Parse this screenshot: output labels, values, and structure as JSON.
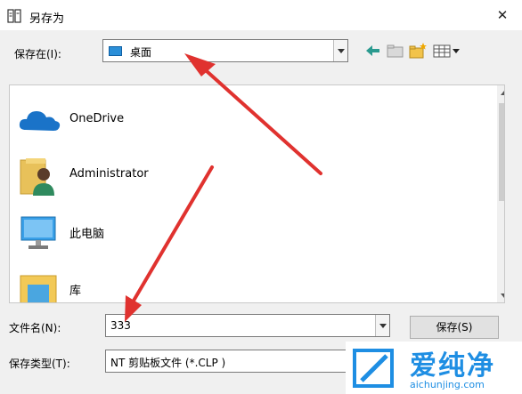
{
  "window": {
    "title": "另存为",
    "close_glyph": "✕"
  },
  "toolbar": {
    "save_in_label": "保存在(I):",
    "location": "桌面",
    "buttons": [
      "back-icon",
      "up-folder-icon",
      "new-folder-icon",
      "view-menu-icon"
    ]
  },
  "items": [
    {
      "label": "OneDrive",
      "icon": "onedrive-cloud-icon"
    },
    {
      "label": "Administrator",
      "icon": "user-folder-icon"
    },
    {
      "label": "此电脑",
      "icon": "this-pc-icon"
    },
    {
      "label": "库",
      "icon": "library-icon"
    }
  ],
  "filename": {
    "label": "文件名(N):",
    "value": "333"
  },
  "filetype": {
    "label": "保存类型(T):",
    "value": "NT 剪贴板文件 (*.CLP )"
  },
  "save_button": "保存(S)",
  "watermark": {
    "text": "爱纯净",
    "url": "aichunjing.com"
  },
  "colors": {
    "arrow": "#e0322f",
    "brand": "#1e8ee3",
    "onedrive": "#1a73c8"
  }
}
